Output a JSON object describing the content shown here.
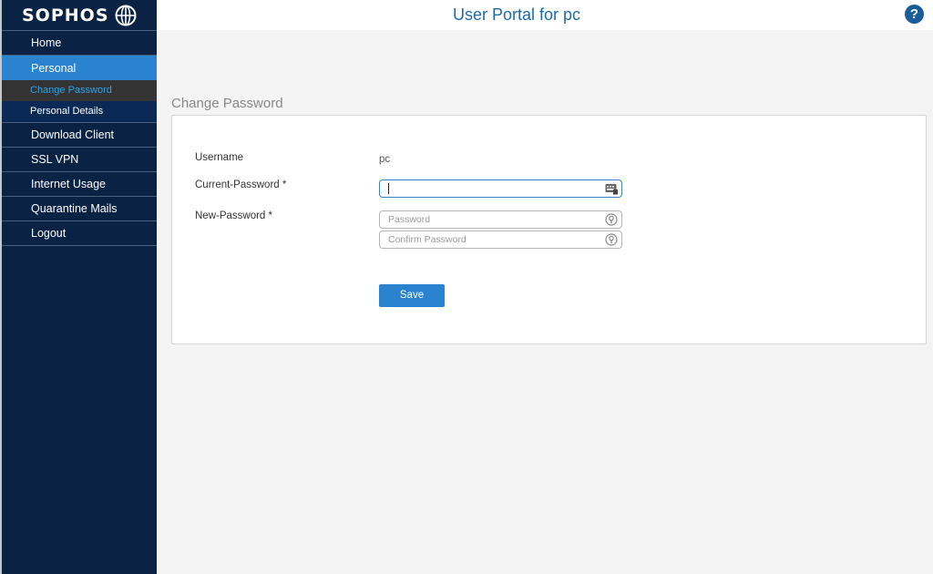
{
  "brand": {
    "name": "SOPHOS"
  },
  "header": {
    "title": "User Portal for pc",
    "help_icon": "question-circle-icon"
  },
  "sidebar": {
    "items": [
      {
        "label": "Home"
      },
      {
        "label": "Personal",
        "active": true
      },
      {
        "label": "Download Client"
      },
      {
        "label": "SSL VPN"
      },
      {
        "label": "Internet Usage"
      },
      {
        "label": "Quarantine Mails"
      },
      {
        "label": "Logout"
      }
    ],
    "sub_items": [
      {
        "label": "Change Password",
        "current": true
      },
      {
        "label": "Personal Details"
      }
    ]
  },
  "form": {
    "section_title": "Change Password",
    "username_label": "Username",
    "username_value": "pc",
    "current_password_label": "Current-Password *",
    "new_password_label": "New-Password *",
    "password_placeholder": "Password",
    "confirm_placeholder": "Confirm Password",
    "save_label": "Save"
  },
  "colors": {
    "sidebar_bg": "#0a2243",
    "accent": "#2a83cf",
    "title": "#1e6aa8",
    "highlight_text": "#2ea3e8"
  }
}
